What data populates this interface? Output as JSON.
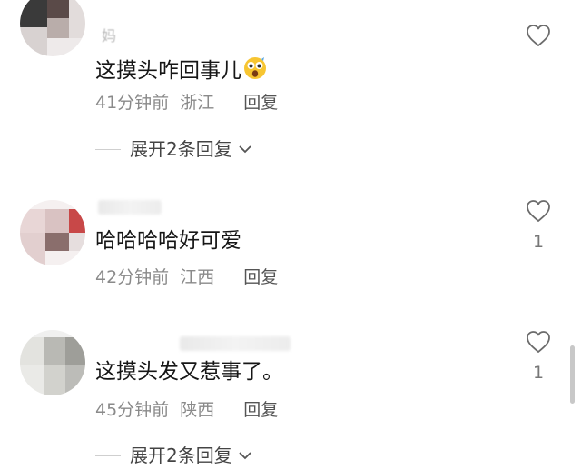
{
  "comments": [
    {
      "username": "妈",
      "text": "这摸头咋回事儿",
      "emoji": "shocked-face-emoji",
      "time": "41分钟前",
      "location": "浙江",
      "reply_label": "回复",
      "expand_label": "展开2条回复",
      "like_count": ""
    },
    {
      "username": "",
      "text": "哈哈哈哈好可爱",
      "time": "42分钟前",
      "location": "江西",
      "reply_label": "回复",
      "like_count": "1"
    },
    {
      "username": "",
      "text": "这摸头发又惹事了。",
      "time": "45分钟前",
      "location": "陕西",
      "reply_label": "回复",
      "expand_label": "展开2条回复",
      "like_count": "1"
    }
  ],
  "icons": {
    "like": "heart-outline-icon",
    "expand": "chevron-down-icon"
  },
  "colors": {
    "text": "#161616",
    "meta": "#8a8a8a",
    "icon": "#6b6b6b"
  }
}
